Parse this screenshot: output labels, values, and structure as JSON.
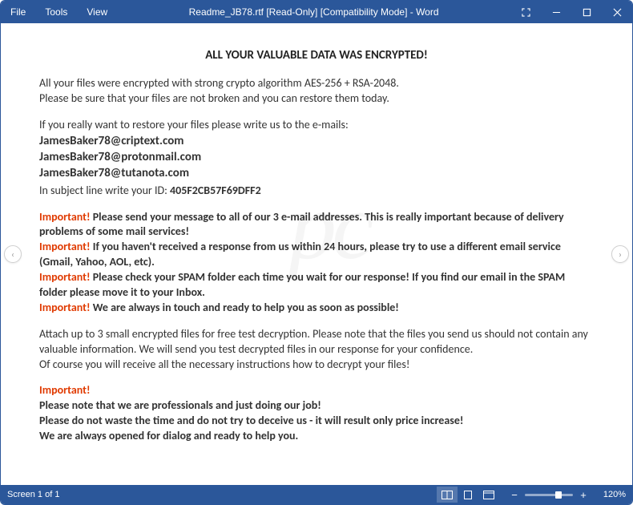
{
  "titlebar": {
    "menu": {
      "file": "File",
      "tools": "Tools",
      "view": "View"
    },
    "title": "Readme_JB78.rtf [Read-Only] [Compatibility Mode] - Word"
  },
  "doc": {
    "heading": "ALL YOUR VALUABLE DATA WAS ENCRYPTED!",
    "intro1": "All your files were encrypted with strong crypto algorithm AES-256 + RSA-2048.",
    "intro2": "Please be sure that your files are not broken and you can restore them today.",
    "restore_line": "If you really want to restore your files please write us to the e-mails:",
    "emails": [
      "JamesBaker78@criptext.com",
      "JamesBaker78@protonmail.com",
      "JamesBaker78@tutanota.com"
    ],
    "id_prefix": "In subject line write your ID: ",
    "id_value": "405F2CB57F69DFF2",
    "important_label": "Important!",
    "imp1": " Please send your message to all of our 3 e-mail addresses. This is really important because of delivery problems of some mail services!",
    "imp2": " If you haven't received a response from us within 24 hours, please try to use a different email service (Gmail, Yahoo, AOL, etc).",
    "imp3": " Please check your SPAM folder each time you wait for our response! If you find our email in the SPAM folder please move it to your Inbox.",
    "imp4": " We are always in touch and ready to help you as soon as possible!",
    "attach1": "Attach up to 3 small encrypted files for free test decryption. Please note that the files you send us should not contain any valuable information. We will send you test decrypted files in our response for your confidence.",
    "attach2": "Of course you will receive all the necessary instructions how to decrypt your files!",
    "sig1": "Please note that we are professionals and just doing our job!",
    "sig2": "Please do not waste the time and do not try to deceive us - it will result only price increase!",
    "sig3": "We are always opened for dialog and ready to help you."
  },
  "status": {
    "screen": "Screen 1 of 1",
    "zoom": "120%"
  }
}
